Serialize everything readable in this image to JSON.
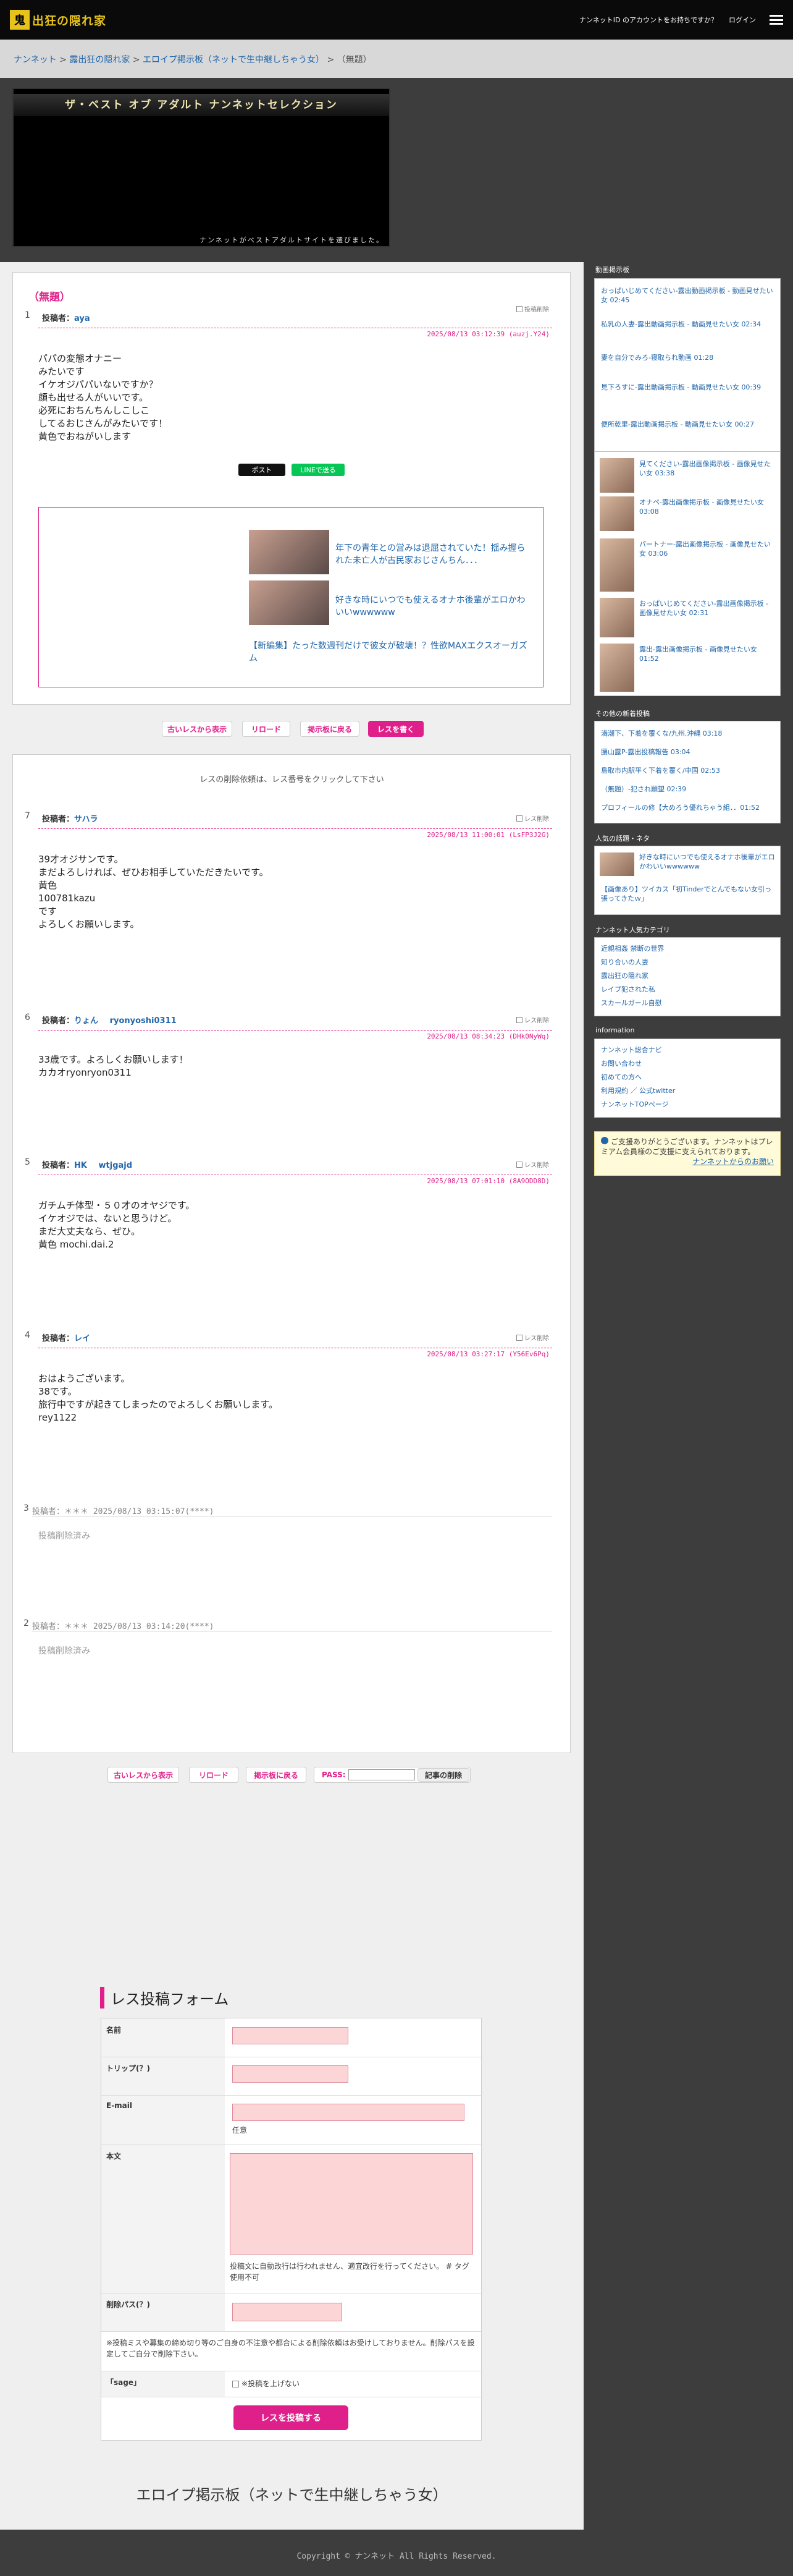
{
  "header": {
    "logo_mark": "鬼",
    "logo_text": "出狂の隠れ家",
    "account_prompt": "ナンネットID のアカウントをお持ちですか？",
    "login": "ログイン"
  },
  "breadcrumb": {
    "items": [
      "ナンネット",
      "露出狂の隠れ家",
      "エロイプ掲示板（ネットで生中継しちゃう女）"
    ],
    "current": "（無題）",
    "sep": ">"
  },
  "banner": {
    "title": "ザ・ベスト オブ アダルト ナンネットセレクション",
    "sub": "ナンネットがベストアダルトサイトを選びました。"
  },
  "thread": {
    "title": "（無題）",
    "delete_label": "投稿削除",
    "num": "1",
    "poster_label": "投稿者：",
    "poster": "aya",
    "date": "2025/08/13 03:12:39 (auzj.Y24)",
    "body": "パパの変態オナニー\nみたいです\nイケオジパパいないですか？\n顔も出せる人がいいです。\n必死におちんちんしこしこ\nしてるおじさんがみたいです！\n黄色でおねがいします",
    "share_x": "ポスト",
    "share_line": "LINEで送る"
  },
  "ad": {
    "items": [
      {
        "text": "年下の青年との営みは退屈されていた！揺み握られた未亡人が古民家おじさんちん．．．"
      },
      {
        "text": "好きな時にいつでも使えるオナホ後輩がエロかわいいwwwwww"
      }
    ],
    "footer": "【新編集】たった数週刊だけで彼女が破壊！？性欲MAXエクスオーガズム"
  },
  "buttons": {
    "old_first": "古いレスから表示",
    "reload": "リロード",
    "back": "掲示板に戻る",
    "write": "レスを書く",
    "pass_label": "PASS:",
    "delete_article": "記事の削除"
  },
  "res_note": "レスの削除依頼は、レス番号をクリックして下さい",
  "res_delete": "レス削除",
  "responses": [
    {
      "num": "7",
      "label": "投稿者：",
      "name": "サハラ",
      "tag": "",
      "date": "2025/08/13 11:00:01 (LsFP3J2G)",
      "body": "39才オジサンです。\nまだよろしければ、ぜひお相手していただきたいです。\n黄色\n100781kazu\nです\nよろしくお願いします。"
    },
    {
      "num": "6",
      "label": "投稿者：",
      "name": "りょん",
      "tag": "ryonyoshi0311",
      "date": "2025/08/13 08:34:23 (DHk0NyWq)",
      "body": "33歳です。よろしくお願いします！\nカカオryonryon0311"
    },
    {
      "num": "5",
      "label": "投稿者：",
      "name": "HK",
      "tag": "wtjgajd",
      "date": "2025/08/13 07:01:10 (8A9ODD8D)",
      "body": "ガチムチ体型・５０才のオヤジです。\nイケオジでは、ないと思うけど。\nまだ大丈夫なら、ぜひ。\n黄色 mochi.dai.2"
    },
    {
      "num": "4",
      "label": "投稿者：",
      "name": "レイ",
      "tag": "",
      "date": "2025/08/13 03:27:17 (Y56Ev6Pq)",
      "body": "おはようございます。\n38です。\n旅行中ですが起きてしまったのでよろしくお願いします。\nrey1122"
    }
  ],
  "deleted": [
    {
      "num": "3",
      "head": "投稿者：＊＊＊ 2025/08/13 03:15:07(****)",
      "text": "投稿削除済み"
    },
    {
      "num": "2",
      "head": "投稿者：＊＊＊ 2025/08/13 03:14:20(****)",
      "text": "投稿削除済み"
    }
  ],
  "sidebar": {
    "s1_title": "動画掲示板",
    "s1": [
      {
        "t": "おっぱいじめてください-露出動画掲示板 - 動画見せたい女",
        "d": "02:45"
      },
      {
        "t": "私乳の人妻-露出動画掲示板 - 動画見せたい女",
        "d": "02:34"
      },
      {
        "t": "妻を自分でみろ-寝取られ動画",
        "d": "01:28"
      },
      {
        "t": "見下ろすに-露出動画掲示板 - 動画見せたい女",
        "d": "00:39"
      },
      {
        "t": "便所乾里-露出動画掲示板 - 動画見せたい女",
        "d": "00:27"
      }
    ],
    "s2_title": "画像で見せたい女",
    "s2": [
      {
        "t": "見てください-露出画像掲示板 - 画像見せたい女",
        "d": "03:38"
      },
      {
        "t": "オナペ-露出画像掲示板 - 画像見せたい女",
        "d": "03:08"
      },
      {
        "t": "パートナー-露出画像掲示板 - 画像見せたい女",
        "d": "03:06"
      },
      {
        "t": "おっぱいじめてください-露出画像掲示板 - 画像見せたい女",
        "d": "02:31"
      },
      {
        "t": "露出-露出画像掲示板 - 画像見せたい女",
        "d": "01:52"
      }
    ],
    "s3_title": "その他の新着投稿",
    "s3": [
      "満潮下、下着を覆くな/九州.沖縄 03:18",
      "腰山露P-露出投稿報告 03:04",
      "島取市内駅平く下着を覆く/中国 02:53",
      "（無題）-犯され願望 02:39",
      "プロフィールの修【大めろう優れちゃう組．．01:52"
    ],
    "s4_title": "人気の話題・ネタ",
    "s4a": "好きな時にいつでも使えるオナホ後輩がエロかわいいwwwwww",
    "s4b": "【画像あり】ツイカス「初Tinderでとんでもない女引っ張ってきたｗ」",
    "s5_title": "ナンネット人気カテゴリ",
    "s5": [
      "近親相姦 禁断の世界",
      "知り合いの人妻",
      "露出狂の隠れ家",
      "レイプ犯された私",
      "スカールガール自慰"
    ],
    "s6_title": "information",
    "s6": [
      "ナンネット総合ナビ",
      "お問い合わせ",
      "初めての方へ",
      "利用規約 ／ 公式twitter",
      "ナンネットTOPページ"
    ],
    "info_text": "ご支援ありがとうございます。ナンネットはプレミアム会員様のご支援に支えられております。",
    "info_link": "ナンネットからのお願い"
  },
  "form": {
    "title": "レス投稿フォーム",
    "name": "名前",
    "trip": "トリップ(？)",
    "email": "E-mail",
    "email_note": "任意",
    "body": "本文",
    "body_note": "投稿文に自動改行は行われません、適宜改行を行ってください。 # タグ使用不可",
    "delpass": "削除パス(？)",
    "notice": "※投稿ミスや募集の締め切り等のご自身の不注意や都合による削除依頼はお受けしておりません。削除パスを設定してご自分で削除下さい。",
    "sage": "「sage」",
    "sage_option": "※投稿を上げない",
    "submit": "レスを投稿する"
  },
  "bottom_title": "エロイプ掲示板（ネットで生中継しちゃう女）",
  "footer": "Copyright © ナンネット All Rights Reserved."
}
